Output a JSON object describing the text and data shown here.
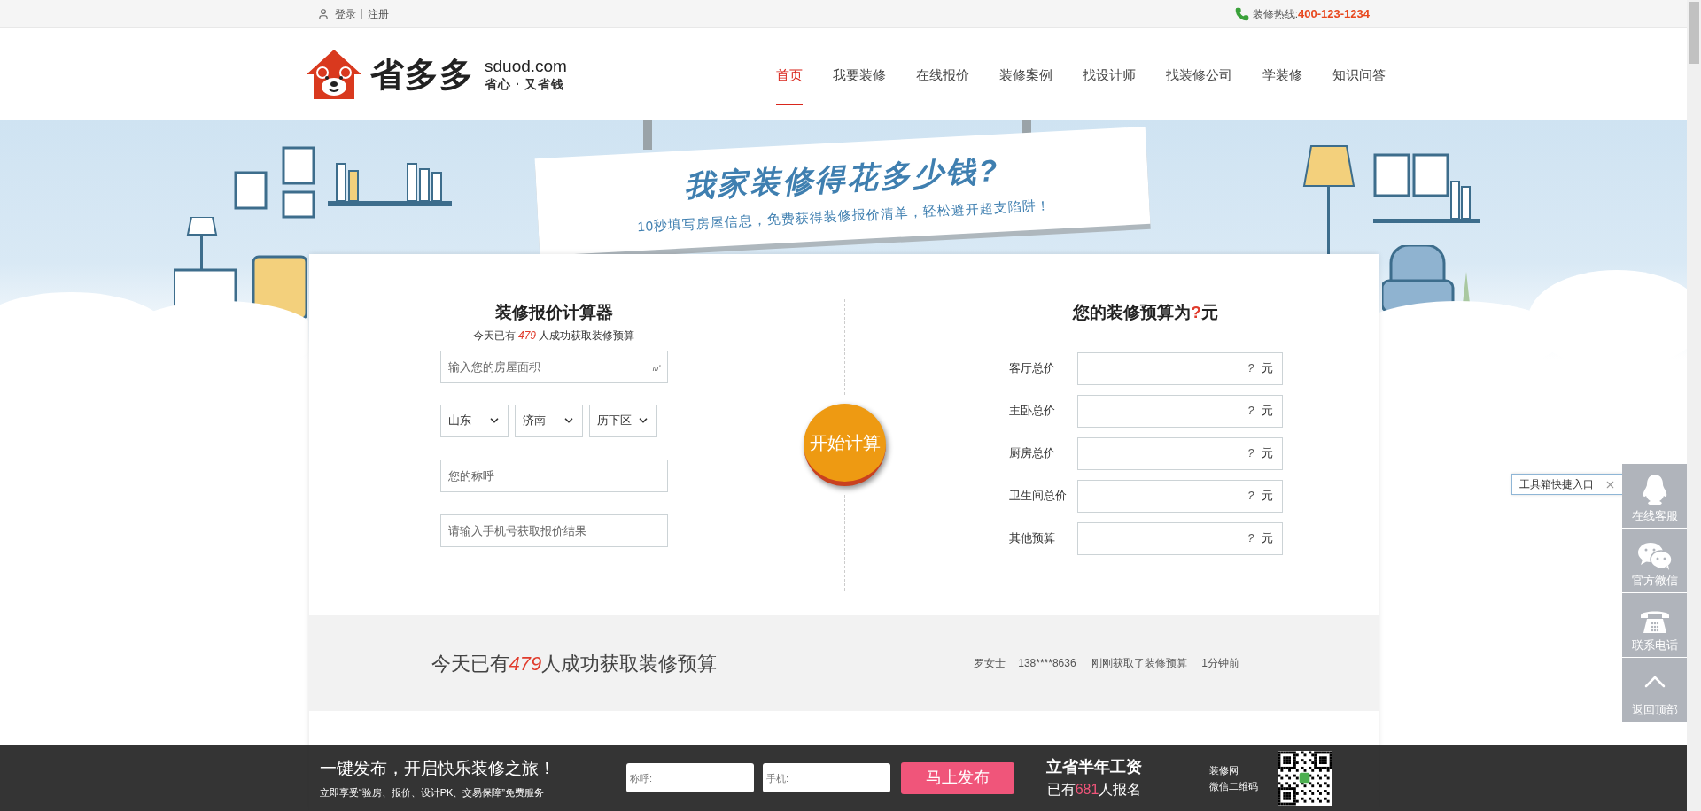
{
  "top_bar": {
    "login": "登录",
    "register": "注册",
    "hotline_label": "装修热线:",
    "hotline": "400-123-1234"
  },
  "logo": {
    "name": "省多多",
    "domain": "sduod.com",
    "slogan": "省心 · 又省钱"
  },
  "nav": [
    {
      "label": "首页",
      "selected": true
    },
    {
      "label": "我要装修",
      "selected": false
    },
    {
      "label": "在线报价",
      "selected": false
    },
    {
      "label": "装修案例",
      "selected": false
    },
    {
      "label": "找设计师",
      "selected": false
    },
    {
      "label": "找装修公司",
      "selected": false
    },
    {
      "label": "学装修",
      "selected": false
    },
    {
      "label": "知识问答",
      "selected": false
    }
  ],
  "banner": {
    "title": "我家装修得花多少钱?",
    "subtitle": "10秒填写房屋信息，免费获得装修报价清单，轻松避开超支陷阱！"
  },
  "calculator": {
    "title": "装修报价计算器",
    "count_prefix": "今天已有",
    "count": "479",
    "count_suffix": "人成功获取装修预算",
    "area": {
      "placeholder": "输入您的房屋面积",
      "unit": "㎡"
    },
    "selects": [
      {
        "value": "山东"
      },
      {
        "value": "济南"
      },
      {
        "value": "历下区"
      }
    ],
    "name": {
      "placeholder": "您的称呼"
    },
    "phone": {
      "placeholder": "请输入手机号获取报价结果"
    },
    "button": "开始计算"
  },
  "budget": {
    "title_prefix": "您的装修预算为",
    "title_value": "?",
    "title_suffix": "元",
    "rows": [
      {
        "label": "客厅总价",
        "value": "?",
        "unit": "元"
      },
      {
        "label": "主卧总价",
        "value": "?",
        "unit": "元"
      },
      {
        "label": "厨房总价",
        "value": "?",
        "unit": "元"
      },
      {
        "label": "卫生间总价",
        "value": "?",
        "unit": "元"
      },
      {
        "label": "其他预算",
        "value": "?",
        "unit": "元"
      }
    ]
  },
  "ticker": {
    "prefix": "今天已有",
    "count": "479",
    "suffix": "人成功获取装修预算",
    "entries": [
      {
        "name": "罗女士",
        "phone": "138****8636",
        "action": "刚刚获取了装修预算",
        "time": "1分钟前"
      }
    ]
  },
  "footer": {
    "title": "一键发布，开启快乐装修之旅！",
    "subtitle": "立即享受“验房、报价、设计PK、交易保障”免费服务",
    "name_placeholder": "称呼:",
    "phone_placeholder": "手机:",
    "button": "马上发布",
    "promo_title": "立省半年工资",
    "promo_prefix": "已有",
    "promo_count": "681",
    "promo_suffix": "人报名",
    "qr_label": "装修网",
    "qr_caption": "微信二维码"
  },
  "tooltip": {
    "text": "工具箱快捷入口"
  },
  "sidebar": [
    {
      "kind": "qq",
      "label": "在线客服"
    },
    {
      "kind": "wechat",
      "label": "官方微信"
    },
    {
      "kind": "phone",
      "label": "联系电话"
    },
    {
      "kind": "top",
      "label": "返回顶部"
    }
  ]
}
